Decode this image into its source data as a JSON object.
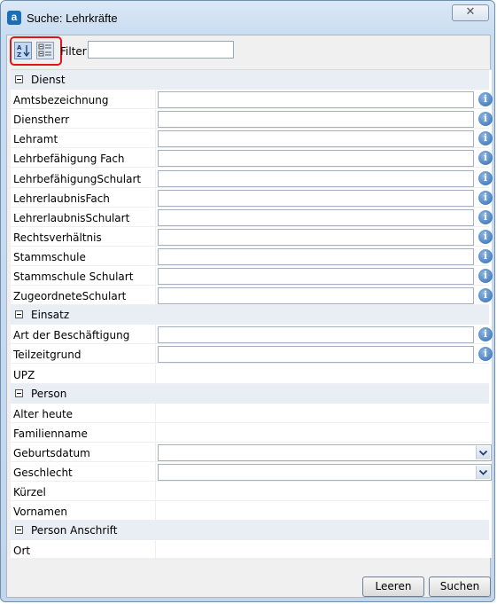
{
  "window": {
    "title": "Suche: Lehrkräfte",
    "app_icon_letter": "a",
    "close_glyph": "✕"
  },
  "toolbar": {
    "sort_icon": "sort-alphabetical-icon",
    "category_icon": "categorized-view-icon",
    "filter_label": "Filter",
    "filter_value": ""
  },
  "grid": {
    "categories": [
      {
        "label": "Dienst",
        "properties": [
          {
            "label": "Amtsbezeichnung",
            "editor": "text",
            "info": true
          },
          {
            "label": "Dienstherr",
            "editor": "text",
            "info": true
          },
          {
            "label": "Lehramt",
            "editor": "text",
            "info": true
          },
          {
            "label": "Lehrbefähigung Fach",
            "editor": "text",
            "info": true
          },
          {
            "label": "LehrbefähigungSchulart",
            "editor": "text",
            "info": true
          },
          {
            "label": "LehrerlaubnisFach",
            "editor": "text",
            "info": true
          },
          {
            "label": "LehrerlaubnisSchulart",
            "editor": "text",
            "info": true
          },
          {
            "label": "Rechtsverhältnis",
            "editor": "text",
            "info": true
          },
          {
            "label": "Stammschule",
            "editor": "text",
            "info": true
          },
          {
            "label": "Stammschule Schulart",
            "editor": "text",
            "info": true
          },
          {
            "label": "ZugeordneteSchulart",
            "editor": "text",
            "info": true
          }
        ]
      },
      {
        "label": "Einsatz",
        "properties": [
          {
            "label": "Art der Beschäftigung",
            "editor": "text",
            "info": true
          },
          {
            "label": "Teilzeitgrund",
            "editor": "text",
            "info": true
          },
          {
            "label": "UPZ",
            "editor": "none",
            "info": false
          }
        ]
      },
      {
        "label": "Person",
        "properties": [
          {
            "label": "Alter heute",
            "editor": "none",
            "info": false
          },
          {
            "label": "Familienname",
            "editor": "none",
            "info": false
          },
          {
            "label": "Geburtsdatum",
            "editor": "select",
            "info": false
          },
          {
            "label": "Geschlecht",
            "editor": "select",
            "info": false
          },
          {
            "label": "Kürzel",
            "editor": "none",
            "info": false
          },
          {
            "label": "Vornamen",
            "editor": "none",
            "info": false
          }
        ]
      },
      {
        "label": "Person Anschrift",
        "properties": [
          {
            "label": "Ort",
            "editor": "none",
            "info": false
          }
        ]
      }
    ]
  },
  "buttons": {
    "clear_label": "Leeren",
    "search_label": "Suchen"
  },
  "colors": {
    "title_gradient_top": "#dbe8f6",
    "highlight_border": "#e0141a",
    "info_icon": "#2f69b0"
  }
}
